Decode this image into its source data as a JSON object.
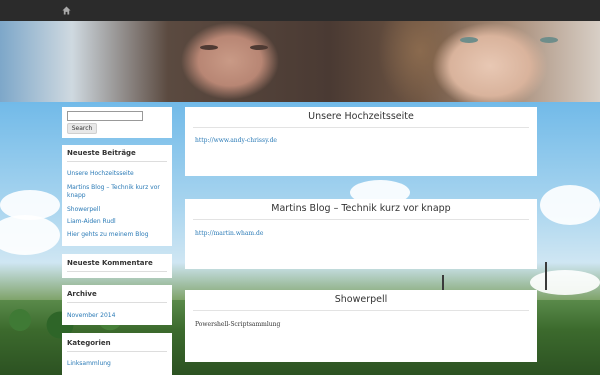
{
  "topbar": {
    "home_icon": "home-icon"
  },
  "banner": {
    "description_icon": "header-photo"
  },
  "sidebar": {
    "search": {
      "placeholder": "",
      "button_label": "Search"
    },
    "recent_posts": {
      "title": "Neueste Beiträge",
      "items": [
        "Unsere Hochzeitsseite",
        "Martins Blog – Technik kurz vor knapp",
        "Showerpell",
        "Liam-Aiden Rudl",
        "Hier gehts zu meinem Blog"
      ]
    },
    "recent_comments": {
      "title": "Neueste Kommentare"
    },
    "archive": {
      "title": "Archive",
      "items": [
        "November 2014"
      ]
    },
    "categories": {
      "title": "Kategorien",
      "items": [
        "Linksammlung"
      ]
    }
  },
  "posts": [
    {
      "title": "Unsere Hochzeitsseite",
      "body": "http://www.andy-chrissy.de",
      "is_link": true
    },
    {
      "title": "Martins Blog – Technik kurz vor knapp",
      "body": "http://martin.wham.de",
      "is_link": true
    },
    {
      "title": "Showerpell",
      "body": "Powershell-Scriptsammlung",
      "is_link": false
    }
  ],
  "colors": {
    "topbar": "#2b2b2b",
    "link": "#2a7ab6",
    "text": "#333333",
    "widget_bg": "#ffffff"
  }
}
